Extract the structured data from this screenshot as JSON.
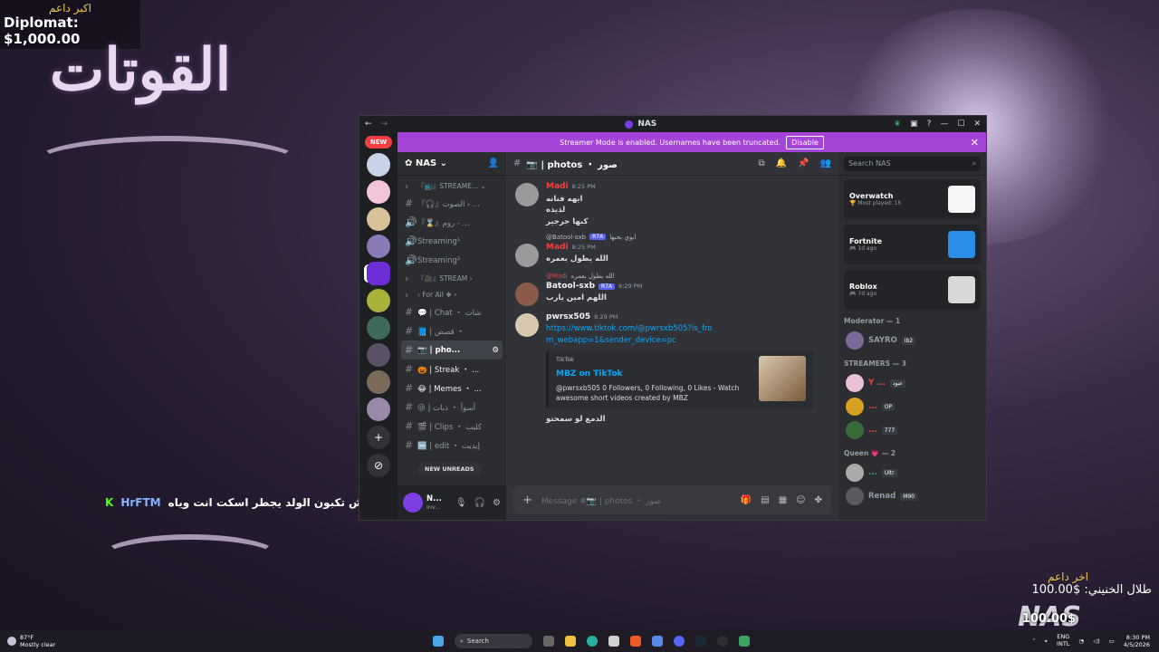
{
  "desktop": {
    "top_donor_label": "اكبر داعم",
    "top_donor_value": "Diplomat: $1,000.00",
    "big_title": "القوتات",
    "chat_overlay": {
      "platform": "K",
      "username": "HrFTM",
      "message": "وش تكبون الولد يجطر اسكت انت وياه"
    },
    "last_donor_label": "اخر داعم",
    "last_donor_value": "طلال الخنيني: $100.00",
    "logo_text": "NAS",
    "logo_amount": "100.00$"
  },
  "window": {
    "title": "NAS",
    "back_icon": "←",
    "forward_icon": "→",
    "minimize": "—",
    "maximize": "☐",
    "close": "✕"
  },
  "server_rail": {
    "new_badge": "NEW",
    "servers": [
      {
        "color": "#c9d3e8"
      },
      {
        "color": "#f2c6d8"
      },
      {
        "color": "#d7c29a"
      },
      {
        "color": "#8a7ab6"
      },
      {
        "color": "#6d2ed8",
        "active": true
      },
      {
        "color": "#a9b23a"
      },
      {
        "color": "#3f6a5a"
      },
      {
        "color": "#5a5068"
      },
      {
        "color": "#7a6a5a"
      },
      {
        "color": "#9a8aa8"
      }
    ],
    "add_label": "+",
    "discover_label": "⊘"
  },
  "banner": {
    "text": "Streamer Mode is enabled. Usernames have been truncated.",
    "disable_label": "Disable",
    "close_label": "✕"
  },
  "guild": {
    "name": "NAS",
    "channels": [
      {
        "type": "cat",
        "label": "『📺』STREAME... ⌄",
        "icon": "›"
      },
      {
        "type": "voice",
        "label": "『🎧』الصوت - ...",
        "icon": "#"
      },
      {
        "type": "voice",
        "label": "『⌛』روم - ...",
        "icon": "🔊"
      },
      {
        "type": "stage",
        "label": "Streaming¹",
        "icon": "🔊"
      },
      {
        "type": "stage",
        "label": "Streaming²",
        "icon": "🔊"
      },
      {
        "type": "cat",
        "label": "『🎥』STREAM ›",
        "icon": "›"
      },
      {
        "type": "cat",
        "label": "‹ For All ❖ ›",
        "icon": "›"
      },
      {
        "type": "text",
        "label": "💬 | Chat ・ شات",
        "icon": "#"
      },
      {
        "type": "text",
        "label": "📘 | قصص ・",
        "icon": "#"
      },
      {
        "type": "text",
        "label": "📷 | pho...",
        "icon": "#",
        "selected": true
      },
      {
        "type": "text",
        "label": "🎃 | Streak ・ ...",
        "icon": "#",
        "bold": true
      },
      {
        "type": "text",
        "label": "😂 | Memes ・ ...",
        "icon": "#",
        "bold": true
      },
      {
        "type": "text",
        "label": "😜 | أسوأ ・ ذبات",
        "icon": "#"
      },
      {
        "type": "text",
        "label": "🎬 | Clips ・ كليب",
        "icon": "#"
      },
      {
        "type": "text",
        "label": "🆒 | edit ・ إيديت",
        "icon": "#"
      }
    ],
    "new_unreads": "NEW UNREADS"
  },
  "user_panel": {
    "name": "N...",
    "status": "Inv..."
  },
  "channel_header": {
    "name": "📷 | photos ・ صور"
  },
  "messages": [
    {
      "author": "Madi",
      "author_color": "#f23f43",
      "time": "8:25 PM",
      "avatar": "#9a9a9a",
      "lines": [
        "ايهه فنانه",
        "لذيذه",
        "كبها جرجير"
      ]
    },
    {
      "reply_to": "@Batool-sxb",
      "reply_tag": "R7A",
      "reply_text": "ابوي يحبها",
      "author": "Madi",
      "author_color": "#f23f43",
      "time": "8:25 PM",
      "avatar": "#9a9a9a",
      "lines": [
        "الله يطول بعمره"
      ]
    },
    {
      "reply_to": "@Madi",
      "reply_text": "الله يطول بعمره",
      "author": "Batool-sxb",
      "author_color": "#f2f3f5",
      "tag": "R7A",
      "time": "8:29 PM",
      "avatar": "#8a5a4a",
      "lines": [
        "اللهم امين يارب"
      ]
    },
    {
      "author": "pwrsx505",
      "author_color": "#f2f3f5",
      "time": "8:29 PM",
      "avatar": "#d9c8b0",
      "link": "https://www.tiktok.com/@pwrsxb505?is_from_webapp=1&sender_device=pc",
      "embed": {
        "provider": "TikTok",
        "title": "MBZ on TikTok",
        "description": "@pwrsxb505 0 Followers, 0 Following, 0 Likes - Watch awesome short videos created by MBZ"
      },
      "after": "الدمع لو سمحتو"
    }
  ],
  "composer": {
    "placeholder": "Message #📷 | photos ・ صور"
  },
  "members": {
    "search_placeholder": "Search NAS",
    "activities": [
      {
        "game": "Overwatch",
        "sub": "🏆 Most played: 1h",
        "color": "#f5f5f5"
      },
      {
        "game": "Fortnite",
        "sub": "🎮 1d ago",
        "color": "#2a8ee8"
      },
      {
        "game": "Roblox",
        "sub": "🎮 7d ago",
        "color": "#d8d8d8"
      }
    ],
    "roles": [
      {
        "name": "Moderator — 1",
        "members": [
          {
            "name": "SAYRO",
            "color": "#949ba4",
            "badge": "ib2",
            "avatar": "#7a6a9a"
          }
        ]
      },
      {
        "name": "STREAMERS — 3",
        "members": [
          {
            "name": "Y ... ",
            "color": "#f23f43",
            "badge": "عبود",
            "avatar": "#e8c0d8"
          },
          {
            "name": "...",
            "color": "#f23f43",
            "badge": "OP",
            "avatar": "#d8a020"
          },
          {
            "name": "...",
            "color": "#f23f43",
            "badge": "777",
            "avatar": "#3a6a3a"
          }
        ]
      },
      {
        "name": "Queen 💗 — 2",
        "members": [
          {
            "name": "...",
            "color": "#3ba55d",
            "badge": "Ultr",
            "avatar": "#aaaaaa"
          },
          {
            "name": "Renad",
            "color": "#949ba4",
            "badge": "M90",
            "avatar": "#5a5a62"
          }
        ]
      }
    ]
  },
  "taskbar": {
    "temp": "87°F",
    "weather": "Mostly clear",
    "search": "Search",
    "lang1": "ENG",
    "lang2": "INTL",
    "time": "8:30 PM",
    "date": "4/5/2026"
  }
}
